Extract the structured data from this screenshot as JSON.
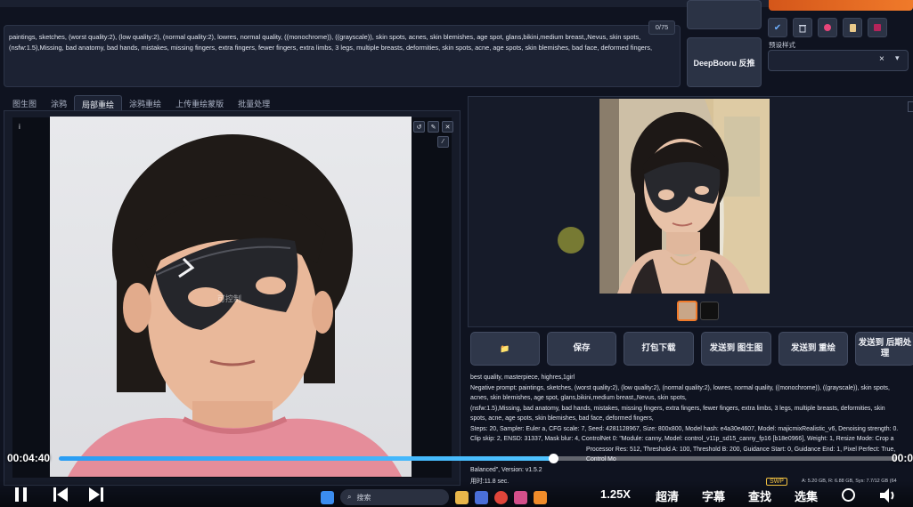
{
  "prompt": {
    "counter": "0/75",
    "negative_text": "paintings, sketches, (worst quality:2), (low quality:2), (normal quality:2), lowres, normal quality, ((monochrome)), ((grayscale)), skin spots, acnes, skin blemishes, age spot, glans,bikini,medium breast,,Nevus, skin spots, (nsfw:1.5),Missing, bad anatomy, bad hands, mistakes, missing fingers, extra fingers, fewer fingers, extra limbs, 3 legs, multiple breasts, deformities, skin spots, acne, age spots, skin blemishes, bad face, deformed fingers,"
  },
  "side": {
    "deepbooru_label": "DeepBooru 反推",
    "preset_label": "预设样式",
    "preset_clear": "×",
    "icons": [
      "check-icon",
      "trash-icon",
      "style-icon",
      "clipboard-icon",
      "save-icon"
    ]
  },
  "tabs": [
    "图生图",
    "涂鸦",
    "局部重绘",
    "涂鸦重绘",
    "上传重绘蒙版",
    "批量处理"
  ],
  "active_tab": "局部重绘",
  "canvas": {
    "info_glyph": "i",
    "tool_icons": [
      "undo-icon",
      "pencil-icon",
      "close-icon",
      "brush-icon"
    ],
    "watermark": "可控制"
  },
  "actions": {
    "folder": "📁",
    "save": "保存",
    "zip": "打包下载",
    "send_img2img": "发送到 图生图",
    "send_inpaint": "发送到 重绘",
    "send_extras": "发送到 后期处理"
  },
  "info": {
    "line1": "best quality, masterpiece, highres,1girl",
    "line2": "Negative prompt: paintings, sketches, (worst quality:2), (low quality:2), (normal quality:2), lowres, normal quality, ((monochrome)), ((grayscale)), skin spots,",
    "line3": "acnes, skin blemishes, age spot, glans,bikini,medium breast,,Nevus, skin spots,",
    "line4": "(nsfw:1.5),Missing, bad anatomy, bad hands, mistakes, missing fingers, extra fingers, fewer fingers, extra limbs, 3 legs, multiple breasts, deformities, skin",
    "line5": "spots, acne, age spots, skin blemishes, bad face, deformed fingers,",
    "line6": "Steps: 20, Sampler: Euler a, CFG scale: 7, Seed: 4281128967, Size: 800x800, Model hash: e4a30e4607, Model: majicmixRealistic_v6, Denoising strength: 0.",
    "line7": "Clip skip: 2, ENSD: 31337, Mask blur: 4, ControlNet 0: \"Module: canny, Model: control_v11p_sd15_canny_fp16 [b18e0966], Weight: 1, Resize Mode: Crop a",
    "line8": "Balanced\", Version: v1.5.2",
    "line9": "用时:11.8 sec.",
    "line7b": "Processor Res: 512, Threshold A: 100, Threshold B: 200, Guidance Start: 0, Guidance End: 1, Pixel Perfect: True, Control Mo"
  },
  "video": {
    "time_current": "00:04:40",
    "time_end": "00:0",
    "progress": 0.59,
    "speed": "1.25X",
    "quality": "超清",
    "subtitle": "字幕",
    "find": "查找",
    "episodes": "选集"
  },
  "taskbar": {
    "search_placeholder": "搜索",
    "badge": "SWP",
    "stats": "A: 5.20 GB, R: 6.88 GB, Sys: 7.7/12 GB (64"
  },
  "colors": {
    "accent_orange": "#f07a2a",
    "progress_blue": "#2a9df4",
    "panel_bg": "#161b29"
  }
}
